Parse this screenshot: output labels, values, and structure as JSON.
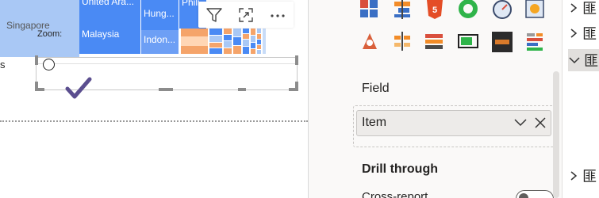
{
  "canvas": {
    "treemap": {
      "labels": {
        "singapore": "Singapore",
        "united_arab": "United Ara...",
        "malaysia": "Malaysia",
        "hungary": "Hung...",
        "indonesia": "Indon...",
        "philippines": "Phili..."
      },
      "colors": {
        "primary": "#4a8af4",
        "light_blue": "#a9c8f5",
        "orange": "#f5a46a"
      }
    },
    "zoom_label": "Zoom:",
    "left_cut_label": "s",
    "visual_header": {
      "filter_icon": "filter-icon",
      "focus_icon": "focus-mode-icon",
      "more_icon": "more-options-icon"
    },
    "check_color": "#5b4e8f"
  },
  "format_pane": {
    "field_section_label": "Field",
    "field_value": "Item",
    "drill_through_label": "Drill through",
    "cross_report_partial": "Cross-report",
    "toggle_state": "Off",
    "viz_icons": [
      "stacked-bar-chart-icon",
      "waterfall-chart-icon",
      "html-visual-icon",
      "donut-chart-icon",
      "gauge-icon",
      "custom-visual-icon",
      "decomposition-tree-icon",
      "slicer-icon",
      "stacked-row-icon",
      "progress-bar-icon",
      "dark-bar-icon",
      "matrix-icon"
    ]
  },
  "fields_pane": {
    "rows": [
      {
        "label": "匪",
        "expanded": false,
        "selected": false
      },
      {
        "label": "匪",
        "expanded": false,
        "selected": false
      },
      {
        "label": "匪",
        "expanded": true,
        "selected": true
      },
      {
        "label": "匪",
        "expanded": false,
        "selected": false
      }
    ]
  }
}
